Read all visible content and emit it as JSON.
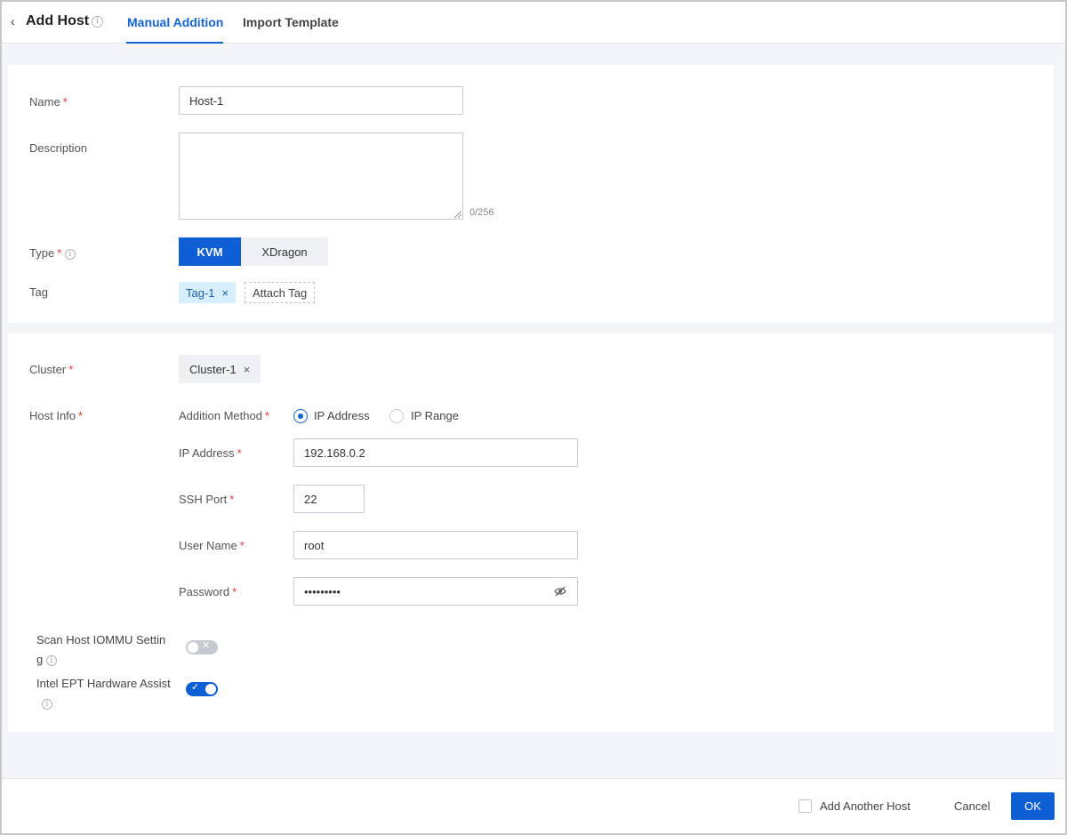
{
  "header": {
    "back_glyph": "‹",
    "title": "Add Host",
    "tabs": [
      {
        "label": "Manual Addition",
        "active": true
      },
      {
        "label": "Import Template",
        "active": false
      }
    ]
  },
  "basic": {
    "name_label": "Name",
    "name_value": "Host-1",
    "description_label": "Description",
    "description_value": "",
    "description_counter": "0/256",
    "type_label": "Type",
    "type_options": [
      "KVM",
      "XDragon"
    ],
    "type_selected": "KVM",
    "tag_label": "Tag",
    "tags": [
      "Tag-1"
    ],
    "attach_tag_label": "Attach Tag"
  },
  "host": {
    "cluster_label": "Cluster",
    "cluster_value": "Cluster-1",
    "host_info_label": "Host Info",
    "addition_method_label": "Addition Method",
    "method_options": [
      "IP Address",
      "IP Range"
    ],
    "method_selected": "IP Address",
    "ip_label": "IP Address",
    "ip_value": "192.168.0.2",
    "ssh_label": "SSH Port",
    "ssh_value": "22",
    "user_label": "User Name",
    "user_value": "root",
    "password_label": "Password",
    "password_value": "•••••••••",
    "scan_iommu_line1": "Scan Host IOMMU Settin",
    "scan_iommu_line2": "g",
    "scan_iommu_on": false,
    "ept_label": "Intel EPT Hardware Assist",
    "ept_on": true
  },
  "footer": {
    "add_another_label": "Add Another Host",
    "cancel_label": "Cancel",
    "ok_label": "OK"
  },
  "colors": {
    "accent": "#0f5fd4",
    "required": "#e03a3a",
    "tag_bg": "#d7eefc"
  },
  "glyphs": {
    "info": "i",
    "close": "×",
    "toggle_check": "✓",
    "toggle_x": "✕"
  }
}
